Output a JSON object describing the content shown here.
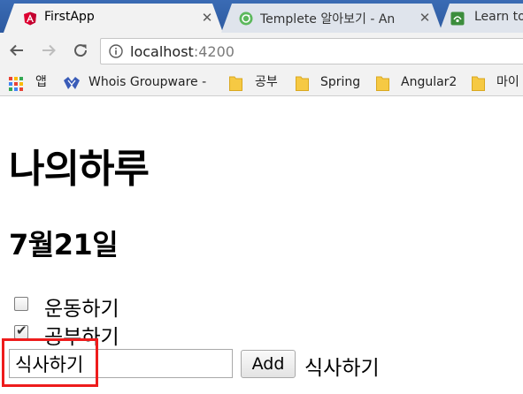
{
  "tabs": [
    {
      "title": "FirstApp",
      "icon": "angular-icon",
      "active": true
    },
    {
      "title": "Templete 알아보기 - An",
      "icon": "refresh-tab-icon",
      "active": false
    },
    {
      "title": "Learn to",
      "icon": "codeschool-icon",
      "active": false
    }
  ],
  "toolbar": {
    "url_host": "localhost",
    "url_port": ":4200"
  },
  "bookmarks": [
    {
      "label": "앱",
      "icon": "apps-grid-icon"
    },
    {
      "label": "Whois Groupware - ",
      "icon": "whois-icon"
    },
    {
      "label": "공부",
      "icon": "folder-icon"
    },
    {
      "label": "Spring",
      "icon": "folder-icon"
    },
    {
      "label": "Angular2",
      "icon": "folder-icon"
    },
    {
      "label": "마이",
      "icon": "folder-icon"
    }
  ],
  "page": {
    "title": "나의하루",
    "date": "7월21일",
    "todos": [
      {
        "label": "운동하기",
        "checked": false
      },
      {
        "label": "공부하기",
        "checked": true
      }
    ],
    "input_value": "식사하기",
    "add_label": "Add",
    "echo": "식사하기"
  },
  "colors": {
    "tab_strip": "#2d5aa0",
    "highlight": "#ee1c1c",
    "angular_red": "#dd0031"
  }
}
